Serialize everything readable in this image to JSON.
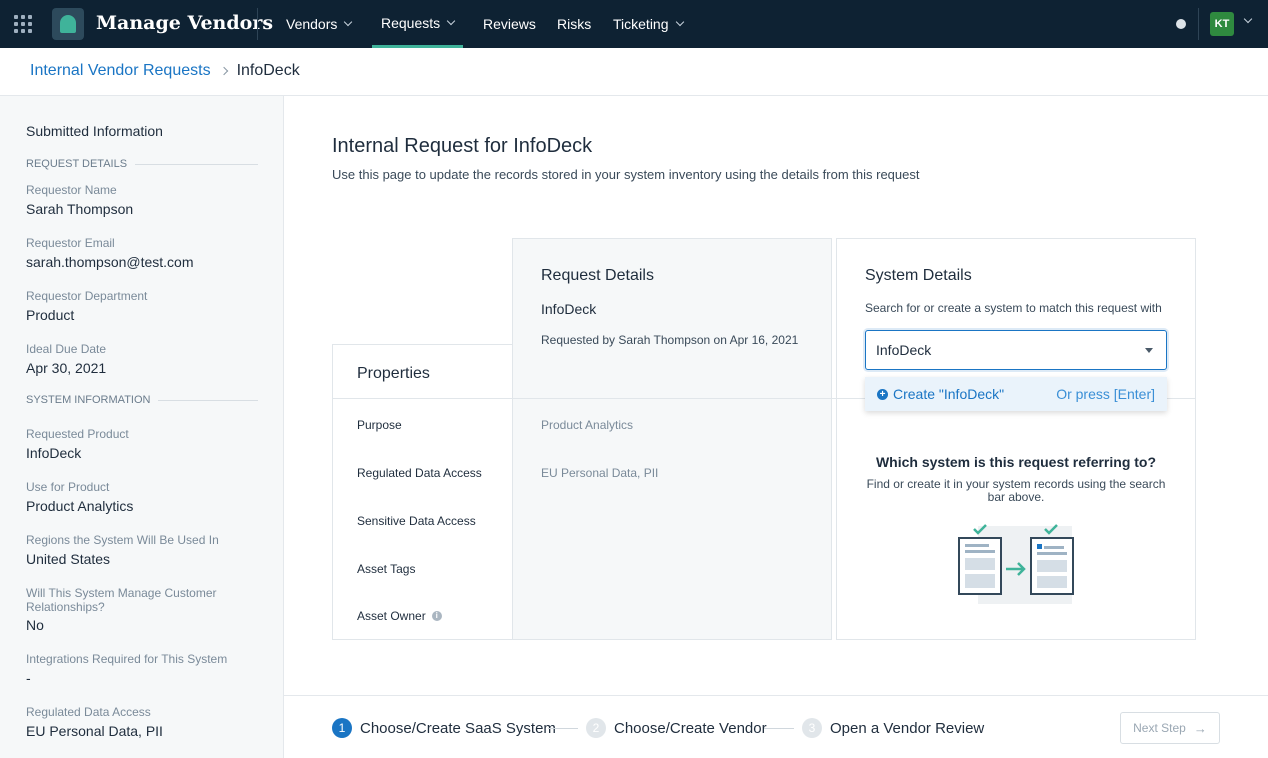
{
  "nav": {
    "brand": "Manage Vendors",
    "items": [
      {
        "label": "Vendors"
      },
      {
        "label": "Requests"
      },
      {
        "label": "Reviews"
      },
      {
        "label": "Risks"
      },
      {
        "label": "Ticketing"
      }
    ],
    "avatar_initials": "KT",
    "accent": "#3fb39a"
  },
  "breadcrumb": {
    "parent": "Internal Vendor Requests",
    "current": "InfoDeck"
  },
  "sidebar": {
    "title": "Submitted Information",
    "section_request": "REQUEST DETAILS",
    "section_system": "SYSTEM INFORMATION",
    "fields": [
      {
        "label": "Requestor Name",
        "value": "Sarah Thompson"
      },
      {
        "label": "Requestor Email",
        "value": "sarah.thompson@test.com"
      },
      {
        "label": "Requestor Department",
        "value": "Product"
      },
      {
        "label": "Ideal Due Date",
        "value": "Apr 30, 2021"
      },
      {
        "label": "Requested Product",
        "value": "InfoDeck"
      },
      {
        "label": "Use for Product",
        "value": "Product Analytics"
      },
      {
        "label": "Regions the System Will Be Used In",
        "value": "United States"
      },
      {
        "label": "Will This System Manage Customer Relationships?",
        "value": "No"
      },
      {
        "label": "Integrations Required for This System",
        "value": "-"
      },
      {
        "label": "Regulated Data Access",
        "value": "EU Personal Data, PII"
      }
    ]
  },
  "main": {
    "title": "Internal Request for InfoDeck",
    "subtitle": "Use this page to update the records stored in your system inventory using the details from this request"
  },
  "properties": {
    "title": "Properties",
    "rows": [
      {
        "name": "Purpose",
        "value": "Product Analytics"
      },
      {
        "name": "Regulated Data Access",
        "value": "EU Personal Data, PII"
      },
      {
        "name": "Sensitive Data Access",
        "value": ""
      },
      {
        "name": "Asset Tags",
        "value": ""
      },
      {
        "name": "Asset Owner",
        "value": ""
      }
    ]
  },
  "request": {
    "title": "Request Details",
    "name": "InfoDeck",
    "requested_by": "Requested by Sarah Thompson on Apr 16, 2021"
  },
  "system": {
    "title": "System Details",
    "hint": "Search for or create a system to match this request with",
    "input_value": "InfoDeck",
    "dropdown_create": "Create \"InfoDeck\"",
    "dropdown_hint": "Or press [Enter]",
    "empty_question": "Which system is this request referring to?",
    "empty_description": "Find or create it in your system records using the search bar above."
  },
  "footer": {
    "steps": [
      {
        "num": "1",
        "label": "Choose/Create SaaS System"
      },
      {
        "num": "2",
        "label": "Choose/Create Vendor"
      },
      {
        "num": "3",
        "label": "Open a Vendor Review"
      }
    ],
    "next_label": "Next Step"
  }
}
